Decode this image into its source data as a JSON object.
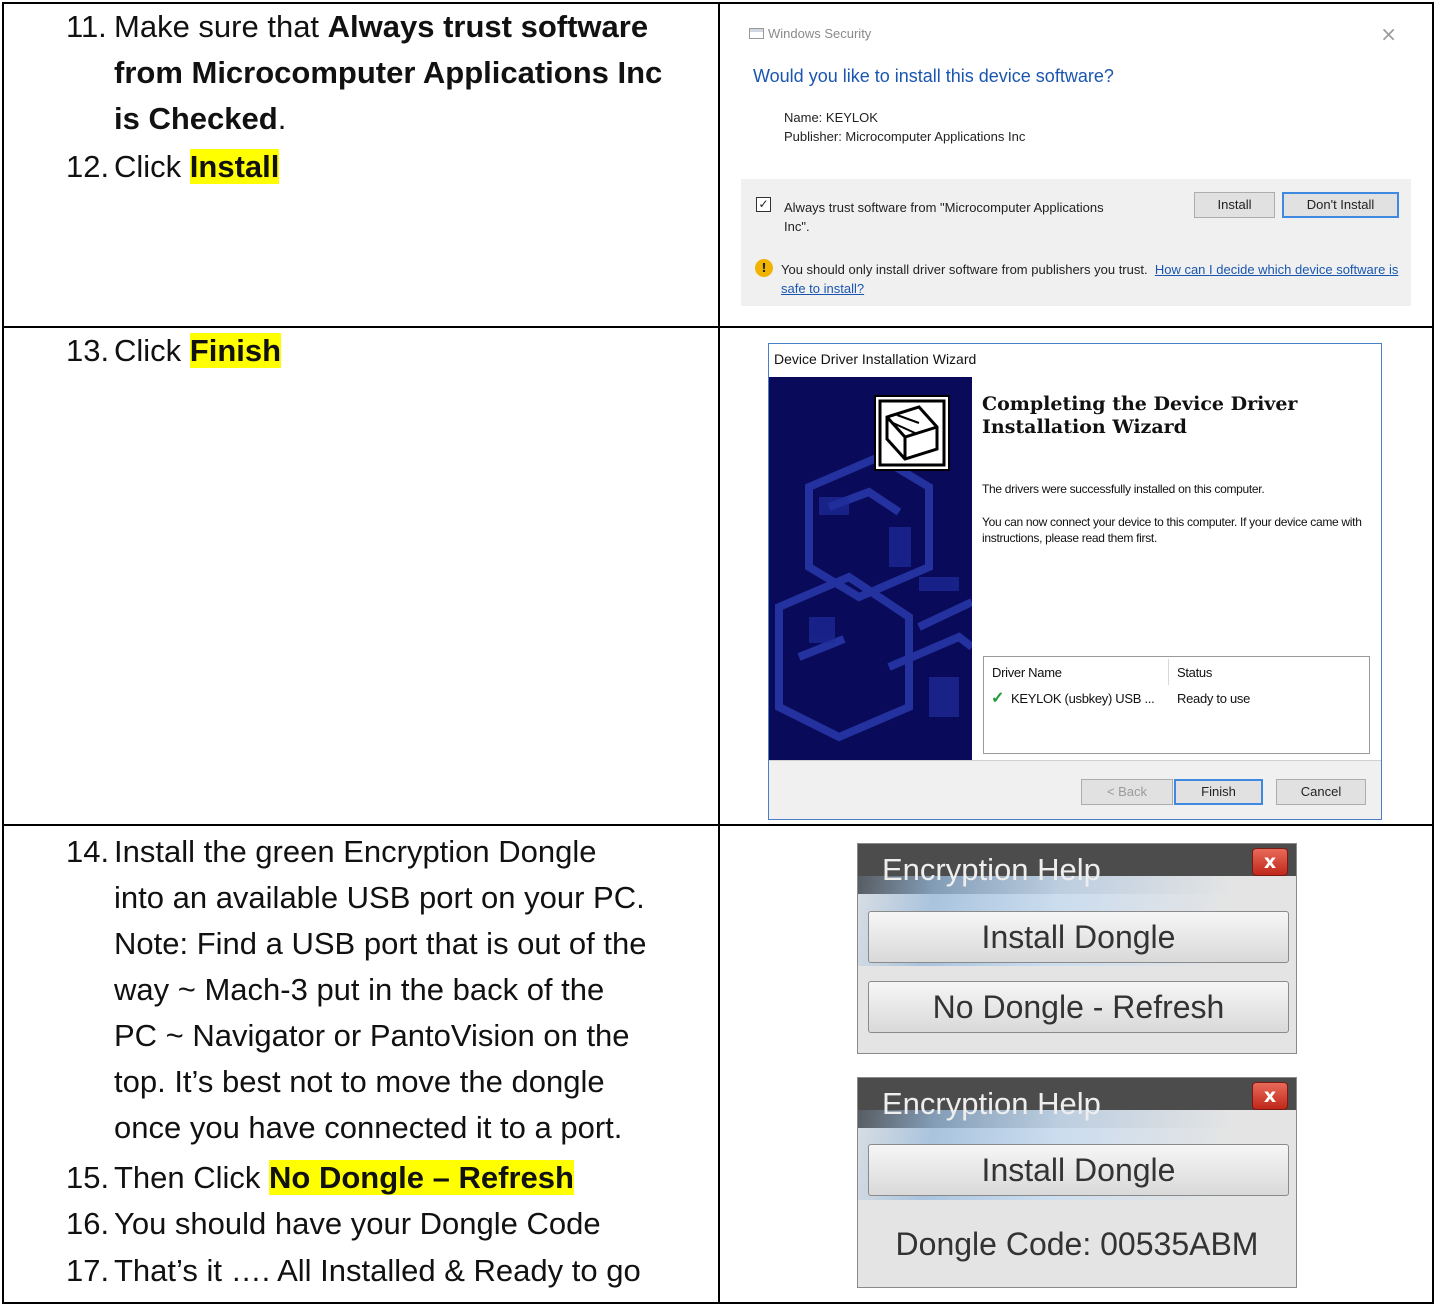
{
  "rows": [
    {
      "steps": [
        {
          "num": "11.",
          "lines": [
            [
              {
                "t": "Make sure that "
              },
              {
                "t": "Always trust software",
                "b": true
              }
            ],
            [
              {
                "t": "from Microcomputer Applications Inc",
                "b": true
              }
            ],
            [
              {
                "t": "is Checked",
                "b": true
              },
              {
                "t": "."
              }
            ]
          ]
        },
        {
          "num": "12.",
          "lines": [
            [
              {
                "t": "Click "
              },
              {
                "t": "Install",
                "hl": true
              }
            ]
          ]
        }
      ]
    },
    {
      "steps": [
        {
          "num": "13.",
          "lines": [
            [
              {
                "t": "Click "
              },
              {
                "t": "Finish",
                "hl": true
              }
            ]
          ]
        }
      ]
    },
    {
      "steps": [
        {
          "num": "14.",
          "lines": [
            [
              {
                "t": "Install the green Encryption Dongle"
              }
            ],
            [
              {
                "t": "into an available USB port on your PC."
              }
            ],
            [
              {
                "t": "Note: Find a USB port that is out of the"
              }
            ],
            [
              {
                "t": "way ~ Mach-3 put in the back of the"
              }
            ],
            [
              {
                "t": "PC ~ Navigator or PantoVision on the"
              }
            ],
            [
              {
                "t": "top. It’s best not to move the dongle"
              }
            ],
            [
              {
                "t": "once you have connected it to a port."
              }
            ]
          ]
        },
        {
          "num": "15.",
          "lines": [
            [
              {
                "t": "Then Click "
              },
              {
                "t": "No Dongle – Refresh",
                "hl": true
              }
            ]
          ]
        },
        {
          "num": "16.",
          "lines": [
            [
              {
                "t": "You should have your Dongle Code"
              }
            ]
          ]
        },
        {
          "num": "17.",
          "lines": [
            [
              {
                "t": "That’s it …. All Installed & Ready to go"
              }
            ]
          ]
        }
      ]
    }
  ],
  "windows_security": {
    "title": "Windows Security",
    "close": "×",
    "question": "Would you like to install this device software?",
    "name_line": "Name: KEYLOK",
    "publisher_line": "Publisher: Microcomputer Applications Inc",
    "checkbox_checked": true,
    "checkbox_mark": "✓",
    "checkbox_label": "Always trust software from \"Microcomputer Applications Inc\".",
    "install_label": "Install",
    "dont_install_label": "Don't Install",
    "shield_glyph": "!",
    "warning_text": "You should only install driver software from publishers you trust.",
    "help_link": "How can I decide which device software is safe to install?"
  },
  "wizard": {
    "caption": "Device Driver Installation Wizard",
    "heading_line1": "Completing the Device Driver",
    "heading_line2": "Installation Wizard",
    "para1": "The drivers were successfully installed on this computer.",
    "para2": "You can now connect your device to this computer. If your device came with instructions, please read them first.",
    "col_driver_name": "Driver Name",
    "col_status": "Status",
    "check_glyph": "✓",
    "driver_name": "KEYLOK (usbkey) USB ...",
    "driver_status": "Ready to use",
    "back_label": "< Back",
    "finish_label": "Finish",
    "cancel_label": "Cancel"
  },
  "encryption_help_1": {
    "title": "Encryption Help",
    "close_glyph": "x",
    "install_button": "Install Dongle",
    "refresh_button": "No Dongle - Refresh"
  },
  "encryption_help_2": {
    "title": "Encryption Help",
    "close_glyph": "x",
    "install_button": "Install Dongle",
    "dongle_code": "Dongle Code: 00535ABM"
  },
  "colors": {
    "highlight": "#ffff00",
    "link_blue": "#1a56b0",
    "wizard_side": "#0a0a5a",
    "wizard_border": "#4a7fc8",
    "close_red": "#c0281a"
  }
}
